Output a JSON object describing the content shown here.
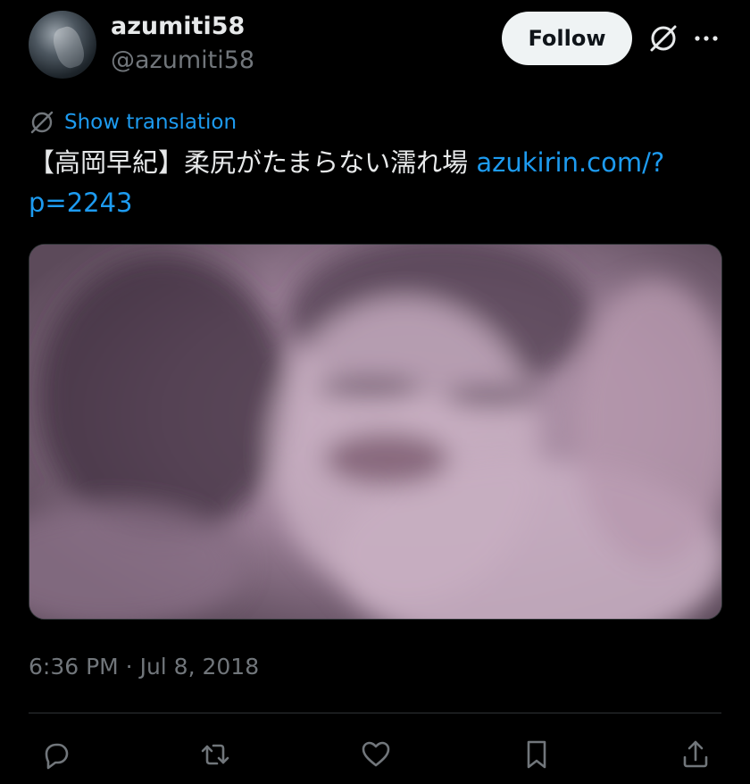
{
  "author": {
    "display_name": "azumiti58",
    "handle": "@azumiti58"
  },
  "header": {
    "follow_label": "Follow"
  },
  "translate": {
    "label": "Show translation"
  },
  "tweet": {
    "text": "【高岡早紀】柔尻がたまらない濡れ場 ",
    "link_text": "azukirin.com/?p=2243",
    "timestamp": "6:36 PM · Jul 8, 2018"
  },
  "icons": {
    "grok": "grok-icon",
    "more": "more-icon",
    "translate": "translate-icon",
    "reply": "reply-icon",
    "retweet": "retweet-icon",
    "like": "heart-icon",
    "bookmark": "bookmark-icon",
    "share": "share-icon"
  },
  "colors": {
    "background": "#000000",
    "text": "#e7e9ea",
    "muted": "#71767b",
    "link": "#1d9bf0",
    "follow_bg": "#eff3f4"
  }
}
